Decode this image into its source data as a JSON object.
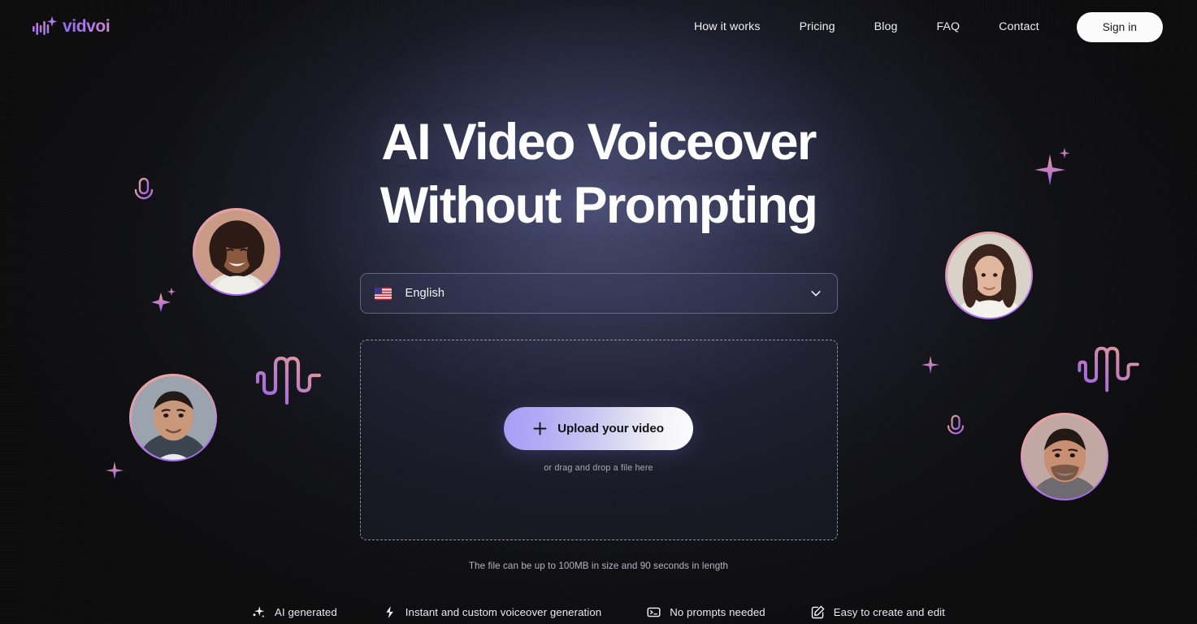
{
  "brand": {
    "name": "vidvoi",
    "logo_icon": "waveform-sparkle-icon"
  },
  "nav": {
    "links": [
      {
        "label": "How it works"
      },
      {
        "label": "Pricing"
      },
      {
        "label": "Blog"
      },
      {
        "label": "FAQ"
      },
      {
        "label": "Contact"
      }
    ],
    "signin_label": "Sign in"
  },
  "hero": {
    "headline_line1": "AI Video Voiceover",
    "headline_line2": "Without Prompting",
    "language": {
      "value": "English",
      "flag": "us-flag-icon",
      "chevron": "chevron-down-icon"
    },
    "upload": {
      "button_label": "Upload your video",
      "plus_icon": "plus-icon",
      "drag_hint": "or drag and drop a file here"
    },
    "file_limit": "The file can be up to 100MB in size and 90 seconds in length"
  },
  "features": [
    {
      "icon": "sparkle-icon",
      "label": "AI generated"
    },
    {
      "icon": "lightning-bolt-icon",
      "label": "Instant and custom voiceover generation"
    },
    {
      "icon": "terminal-prompt-icon",
      "label": "No prompts needed"
    },
    {
      "icon": "pencil-square-icon",
      "label": "Easy to create and edit"
    }
  ],
  "colors": {
    "page_background": "#0d0d0e",
    "center_glow": "#4a4e74",
    "accent_purple": "#9a5ff0",
    "accent_pink": "#e9a79a",
    "signin_background": "#fbfbfb",
    "upload_gradient_start": "#a79cf6",
    "upload_gradient_end": "#fcfcfc"
  }
}
